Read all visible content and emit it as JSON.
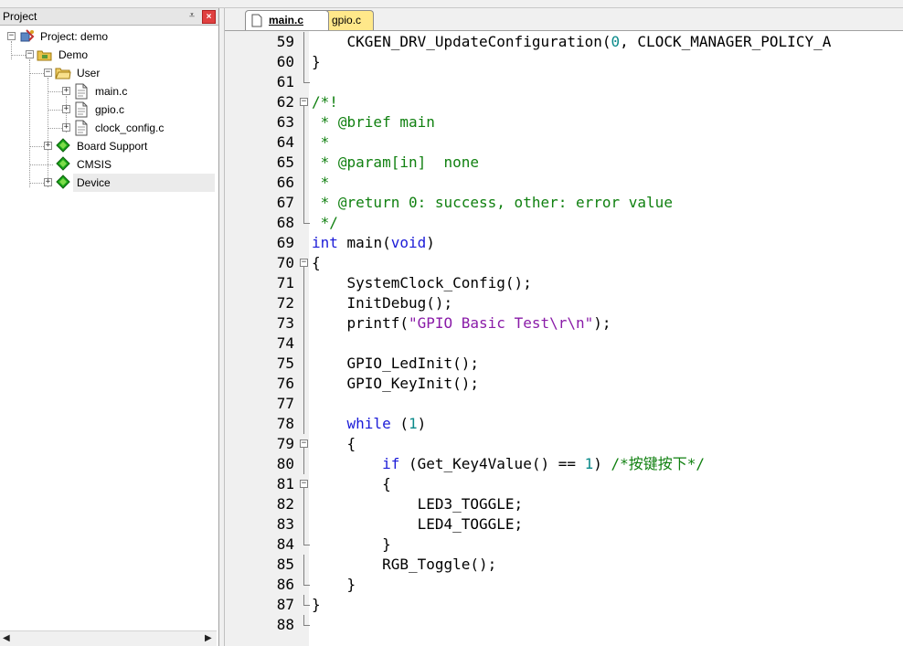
{
  "panel": {
    "title": "Project",
    "pin_glyph": "⩡",
    "close_glyph": "×"
  },
  "tree": {
    "root": "Project: demo",
    "target": "Demo",
    "group_user": "User",
    "files": [
      "main.c",
      "gpio.c",
      "clock_config.c"
    ],
    "board_support": "Board Support",
    "cmsis": "CMSIS",
    "device": "Device"
  },
  "tabs": [
    {
      "label": "main.c",
      "active": true
    },
    {
      "label": "gpio.c",
      "active": false
    }
  ],
  "colors": {
    "keyword": "#1c1cd8",
    "comment": "#108010",
    "string": "#8a1ca8",
    "number": "#0a8a8a",
    "gpio_tab": "#ffe88a",
    "component_icon": "#1aa51a"
  },
  "icons": {
    "expanded": "minus-box",
    "collapsed": "plus-box",
    "project": "project-icon",
    "target": "target-folder-icon",
    "folder": "folder-icon",
    "file": "c-file-icon",
    "component": "green-diamond-icon"
  },
  "code_lines": [
    {
      "n": "59",
      "fold": "line",
      "segments": [
        {
          "t": "    CKGEN_DRV_UpdateConfiguration(",
          "c": ""
        },
        {
          "t": "0",
          "c": "num"
        },
        {
          "t": ", CLOCK_MANAGER_POLICY_A",
          "c": ""
        }
      ]
    },
    {
      "n": "60",
      "fold": "line",
      "segments": [
        {
          "t": "}",
          "c": ""
        }
      ]
    },
    {
      "n": "61",
      "fold": "end",
      "segments": []
    },
    {
      "n": "62",
      "fold": "open",
      "segments": [
        {
          "t": "/*!",
          "c": "cm"
        }
      ]
    },
    {
      "n": "63",
      "fold": "line",
      "segments": [
        {
          "t": " * @brief main",
          "c": "cm"
        }
      ]
    },
    {
      "n": "64",
      "fold": "line",
      "segments": [
        {
          "t": " *",
          "c": "cm"
        }
      ]
    },
    {
      "n": "65",
      "fold": "line",
      "segments": [
        {
          "t": " * @param[in]  none",
          "c": "cm"
        }
      ]
    },
    {
      "n": "66",
      "fold": "line",
      "segments": [
        {
          "t": " *",
          "c": "cm"
        }
      ]
    },
    {
      "n": "67",
      "fold": "line",
      "segments": [
        {
          "t": " * @return 0: success, other: error value",
          "c": "cm"
        }
      ]
    },
    {
      "n": "68",
      "fold": "end",
      "segments": [
        {
          "t": " */",
          "c": "cm"
        }
      ]
    },
    {
      "n": "69",
      "fold": "",
      "segments": [
        {
          "t": "int",
          "c": "kw"
        },
        {
          "t": " main(",
          "c": ""
        },
        {
          "t": "void",
          "c": "kw"
        },
        {
          "t": ")",
          "c": ""
        }
      ]
    },
    {
      "n": "70",
      "fold": "open",
      "segments": [
        {
          "t": "{",
          "c": ""
        }
      ]
    },
    {
      "n": "71",
      "fold": "line",
      "segments": [
        {
          "t": "    SystemClock_Config();",
          "c": ""
        }
      ]
    },
    {
      "n": "72",
      "fold": "line",
      "segments": [
        {
          "t": "    InitDebug();",
          "c": ""
        }
      ]
    },
    {
      "n": "73",
      "fold": "line",
      "segments": [
        {
          "t": "    printf(",
          "c": ""
        },
        {
          "t": "\"GPIO Basic Test\\r\\n\"",
          "c": "str"
        },
        {
          "t": ");",
          "c": ""
        }
      ]
    },
    {
      "n": "74",
      "fold": "line",
      "segments": []
    },
    {
      "n": "75",
      "fold": "line",
      "segments": [
        {
          "t": "    GPIO_LedInit();",
          "c": ""
        }
      ]
    },
    {
      "n": "76",
      "fold": "line",
      "segments": [
        {
          "t": "    GPIO_KeyInit();",
          "c": ""
        }
      ]
    },
    {
      "n": "77",
      "fold": "line",
      "segments": []
    },
    {
      "n": "78",
      "fold": "line",
      "segments": [
        {
          "t": "    ",
          "c": ""
        },
        {
          "t": "while",
          "c": "kw"
        },
        {
          "t": " (",
          "c": ""
        },
        {
          "t": "1",
          "c": "num"
        },
        {
          "t": ")",
          "c": ""
        }
      ]
    },
    {
      "n": "79",
      "fold": "open",
      "segments": [
        {
          "t": "    {",
          "c": ""
        }
      ]
    },
    {
      "n": "80",
      "fold": "line",
      "segments": [
        {
          "t": "        ",
          "c": ""
        },
        {
          "t": "if",
          "c": "kw"
        },
        {
          "t": " (Get_Key4Value() == ",
          "c": ""
        },
        {
          "t": "1",
          "c": "num"
        },
        {
          "t": ") ",
          "c": ""
        },
        {
          "t": "/*按键按下*/",
          "c": "cm"
        }
      ]
    },
    {
      "n": "81",
      "fold": "open",
      "segments": [
        {
          "t": "        {",
          "c": ""
        }
      ]
    },
    {
      "n": "82",
      "fold": "line",
      "segments": [
        {
          "t": "            LED3_TOGGLE;",
          "c": ""
        }
      ]
    },
    {
      "n": "83",
      "fold": "line",
      "segments": [
        {
          "t": "            LED4_TOGGLE;",
          "c": ""
        }
      ]
    },
    {
      "n": "84",
      "fold": "end",
      "segments": [
        {
          "t": "        }",
          "c": ""
        }
      ]
    },
    {
      "n": "85",
      "fold": "line",
      "segments": [
        {
          "t": "        RGB_Toggle();",
          "c": ""
        }
      ]
    },
    {
      "n": "86",
      "fold": "end",
      "segments": [
        {
          "t": "    }",
          "c": ""
        }
      ]
    },
    {
      "n": "87",
      "fold": "end",
      "segments": [
        {
          "t": "}",
          "c": ""
        }
      ]
    },
    {
      "n": "88",
      "fold": "end",
      "segments": []
    }
  ]
}
